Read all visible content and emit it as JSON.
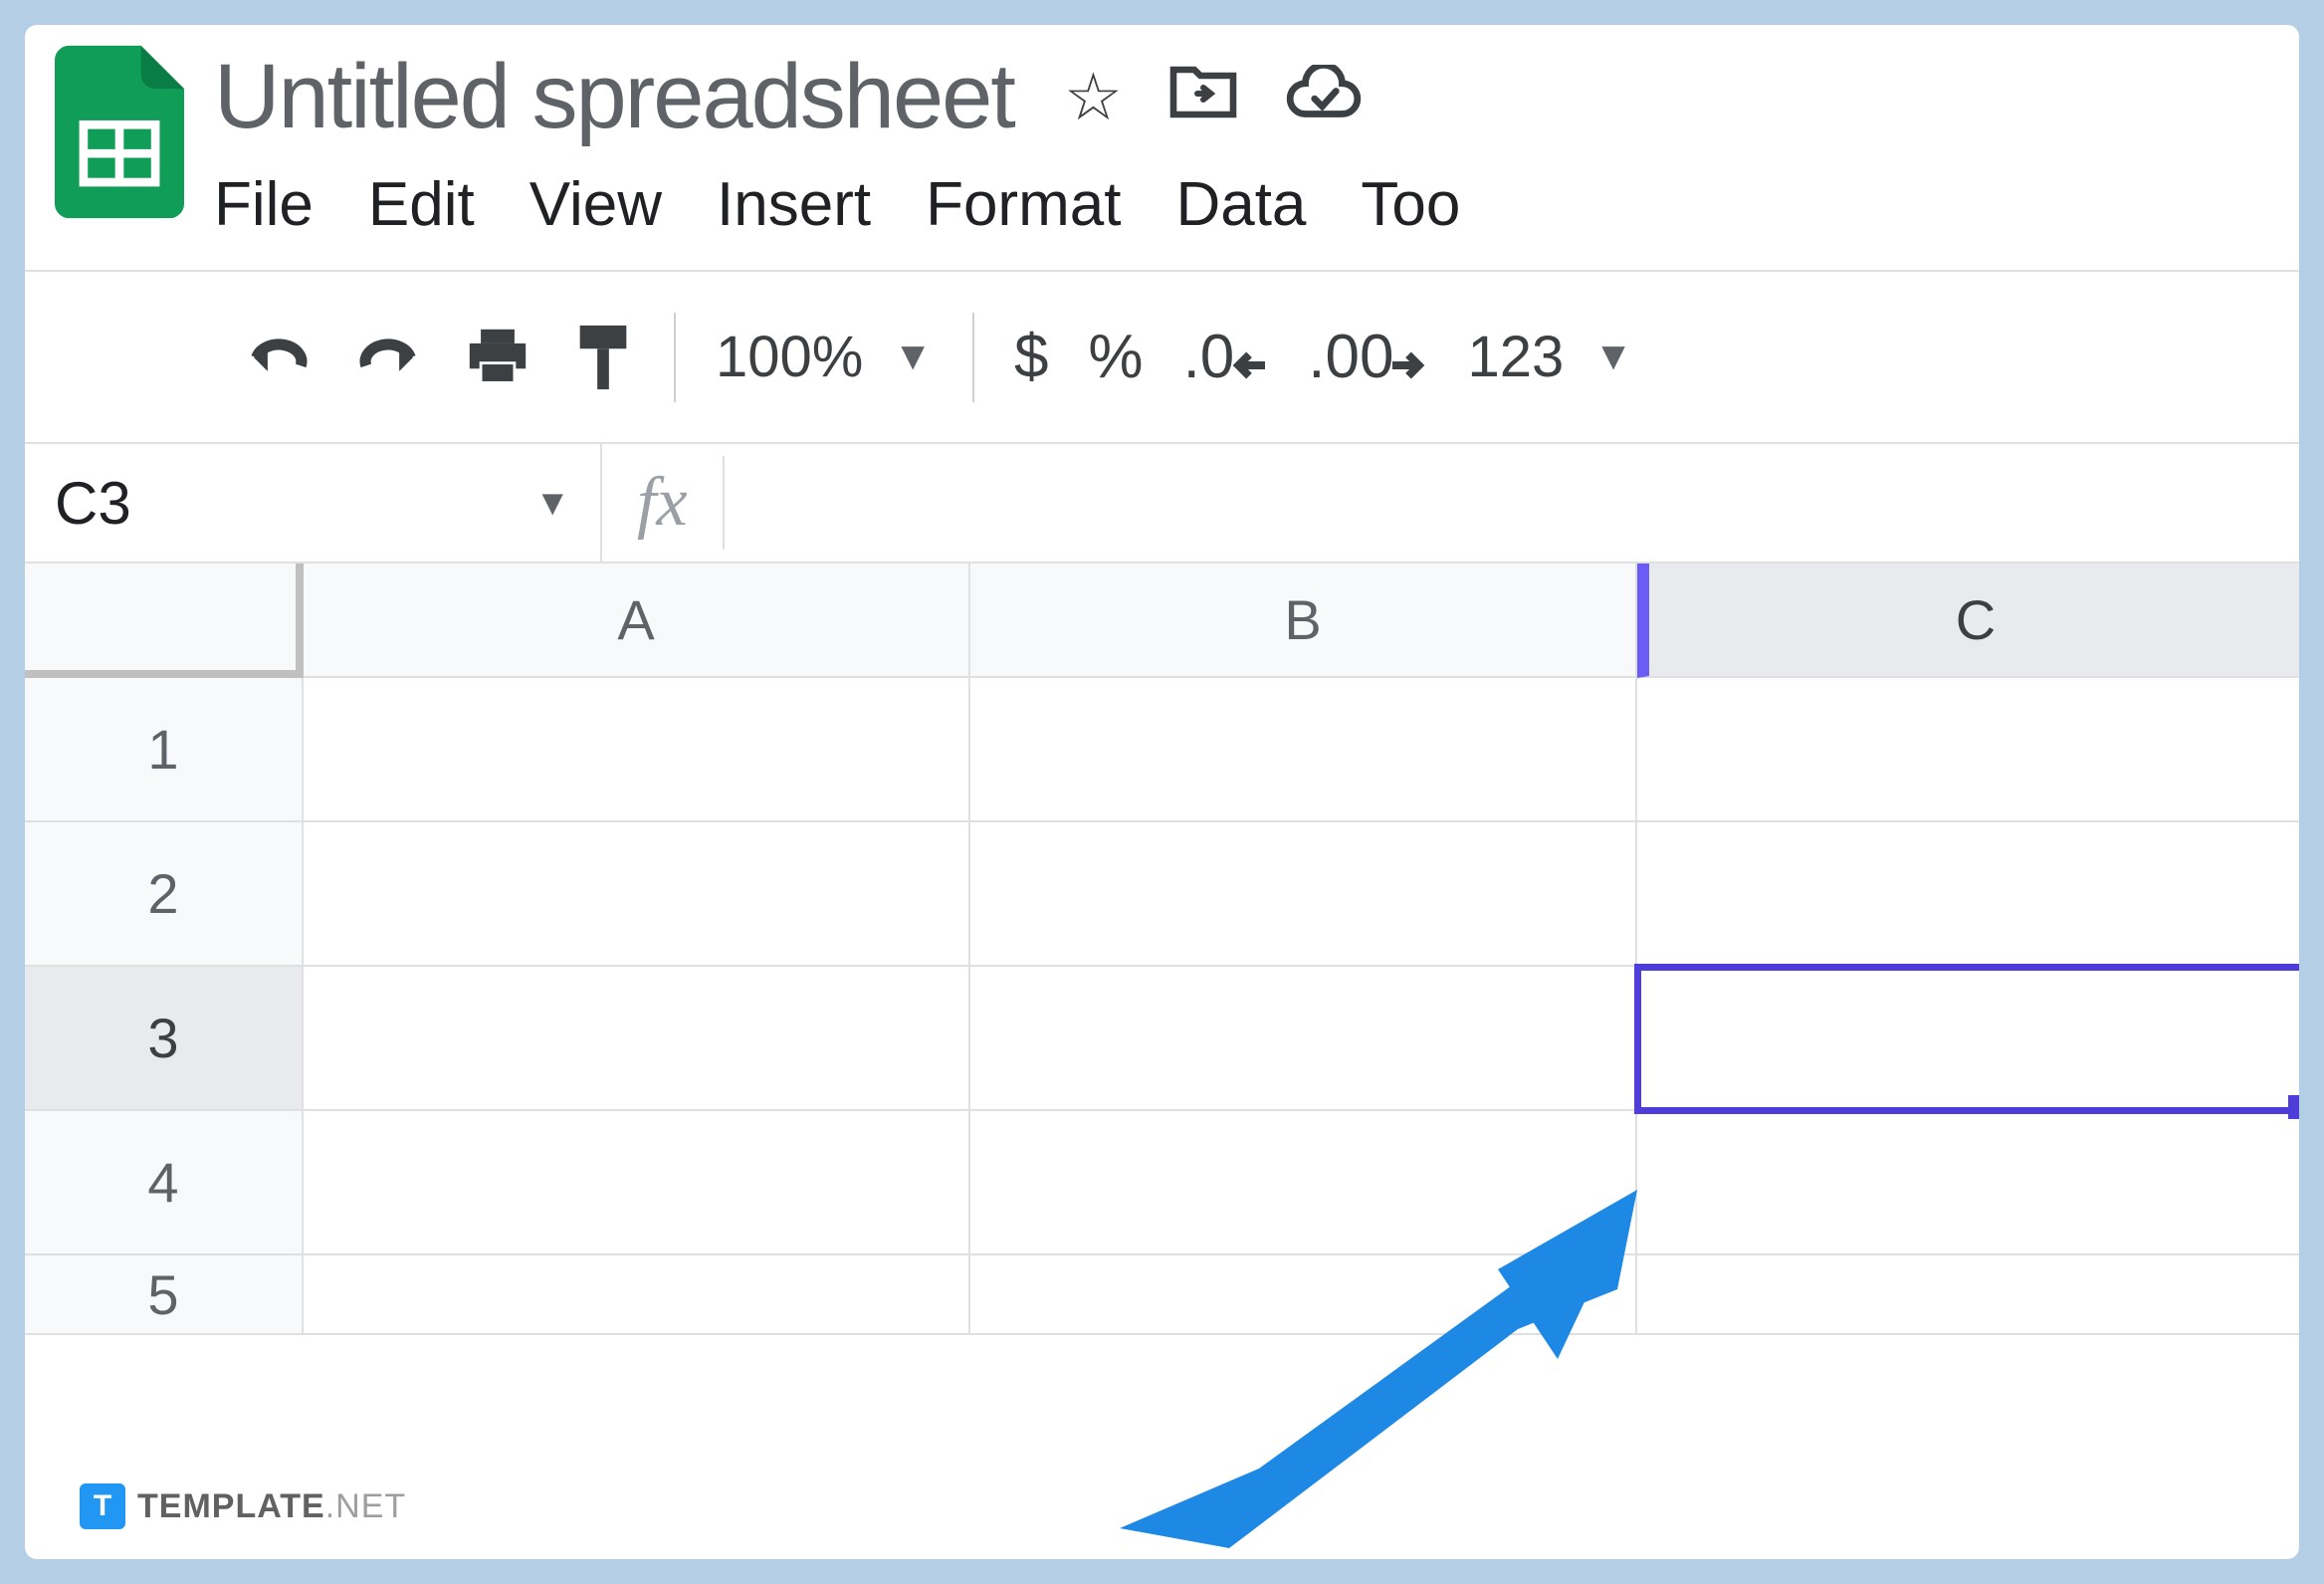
{
  "document": {
    "title": "Untitled spreadsheet"
  },
  "menus": {
    "file": "File",
    "edit": "Edit",
    "view": "View",
    "insert": "Insert",
    "format": "Format",
    "data": "Data",
    "tools": "Too"
  },
  "toolbar": {
    "zoom": "100%",
    "currency": "$",
    "percent": "%",
    "dec_less": ".0",
    "dec_more": ".00",
    "num_format": "123"
  },
  "name_box": {
    "value": "C3"
  },
  "fx": {
    "label": "fx",
    "value": ""
  },
  "columns": [
    "A",
    "B",
    "C"
  ],
  "rows": [
    "1",
    "2",
    "3",
    "4",
    "5"
  ],
  "selected": {
    "col": "C",
    "row": "3"
  },
  "watermark": {
    "badge": "T",
    "bold": "TEMPLATE",
    "light": ".NET"
  }
}
